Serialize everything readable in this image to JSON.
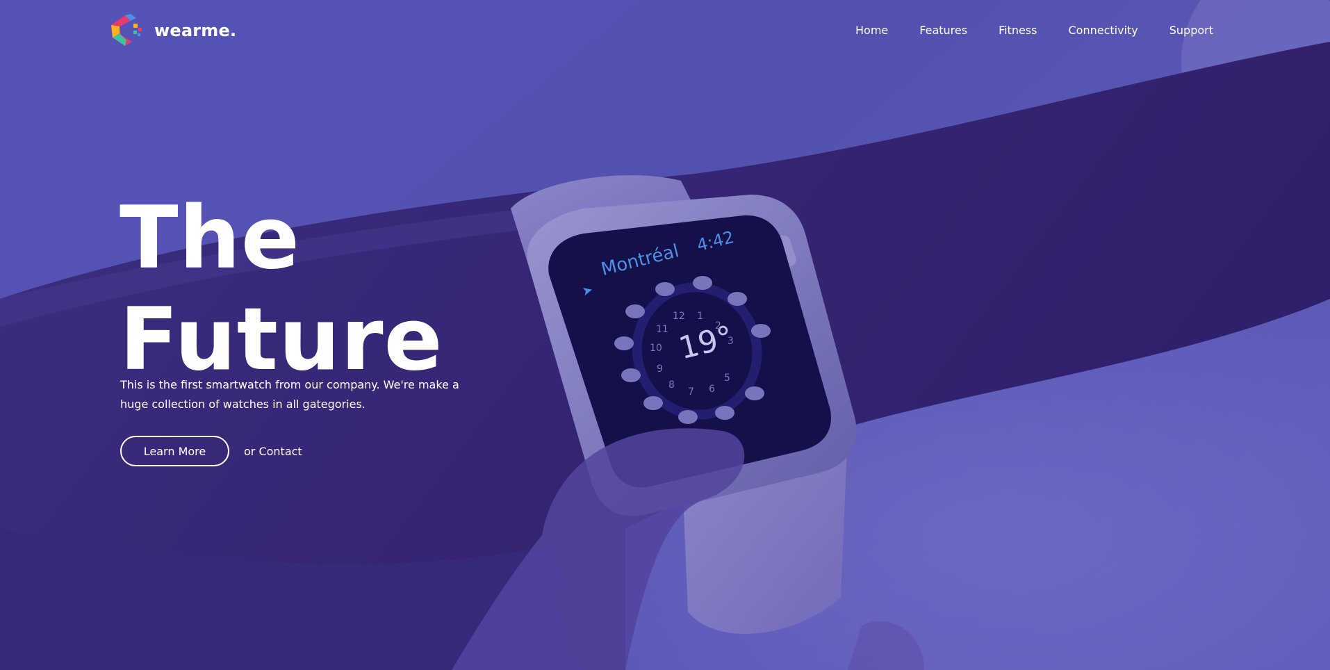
{
  "brand": {
    "name": "wearme.",
    "logo_icon": "wearme-logo-icon"
  },
  "nav": {
    "items": [
      {
        "label": "Home"
      },
      {
        "label": "Features"
      },
      {
        "label": "Fitness"
      },
      {
        "label": "Connectivity"
      },
      {
        "label": "Support"
      }
    ]
  },
  "hero": {
    "headline_line1": "The",
    "headline_line2": "Future",
    "description": "This is the first smartwatch from our company. We're make a huge collection of watches in all gategories.",
    "primary_button": "Learn More",
    "secondary_link": "or Contact",
    "watch_screen": {
      "city": "Montréal",
      "time": "4:42",
      "temperature": "19°",
      "dial_numbers": [
        "12",
        "1",
        "2",
        "3",
        "5",
        "6",
        "7",
        "8",
        "9",
        "10",
        "11"
      ]
    }
  },
  "colors": {
    "overlay": "#5a52c4",
    "deep_purple": "#2d1b66",
    "watch_screen": "#0b0a3c",
    "watch_accent": "#4f8fe6",
    "text": "#ffffff"
  }
}
